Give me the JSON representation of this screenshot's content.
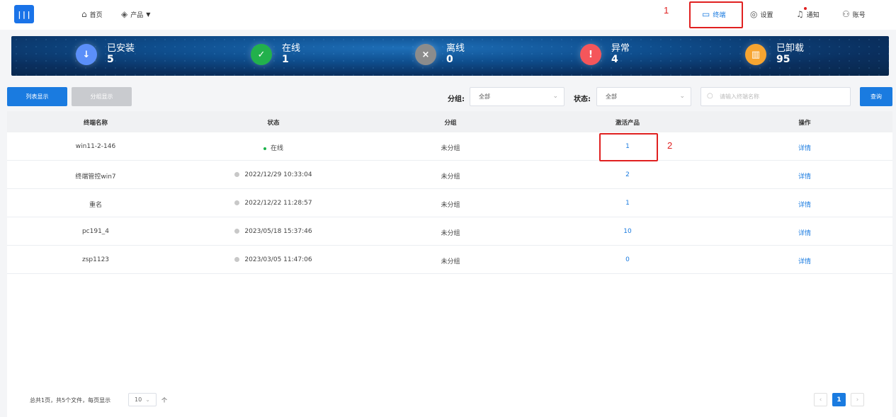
{
  "topbar": {
    "logo_text": "|||",
    "nav": [
      {
        "icon": "home-icon",
        "label": "首页"
      },
      {
        "icon": "layers-icon",
        "label": "产品"
      }
    ],
    "right": [
      {
        "icon": "monitor-icon",
        "label": "终端",
        "active": true
      },
      {
        "icon": "gear-icon",
        "label": "设置"
      },
      {
        "icon": "bell-icon",
        "label": "通知"
      },
      {
        "icon": "user-icon",
        "label": "账号"
      }
    ],
    "annotation_1": "1"
  },
  "stats": [
    {
      "label": "已安装",
      "value": "5",
      "color": "#5b8ff9"
    },
    {
      "label": "在线",
      "value": "1",
      "color": "#22b14c"
    },
    {
      "label": "离线",
      "value": "0",
      "color": "#8c8c8c"
    },
    {
      "label": "异常",
      "value": "4",
      "color": "#f5565b"
    },
    {
      "label": "已卸载",
      "value": "95",
      "color": "#f7a531"
    }
  ],
  "toolbar": {
    "list_view": "列表显示",
    "group_view": "分组显示",
    "group_label": "分组:",
    "group_value": "全部",
    "status_label": "状态:",
    "status_value": "全部",
    "search_placeholder": "请输入终端名称",
    "query": "查询"
  },
  "table": {
    "headers": [
      "终端名称",
      "状态",
      "分组",
      "激活产品",
      "操作"
    ],
    "rows": [
      {
        "name": "win11-2-146",
        "status": "在线",
        "online": true,
        "group": "未分组",
        "products": "1",
        "action": "详情"
      },
      {
        "name": "终端管控win7",
        "status": "2022/12/29 10:33:04",
        "online": false,
        "group": "未分组",
        "products": "2",
        "action": "详情"
      },
      {
        "name": "重名",
        "status": "2022/12/22 11:28:57",
        "online": false,
        "group": "未分组",
        "products": "1",
        "action": "详情"
      },
      {
        "name": "pc191_4",
        "status": "2023/05/18 15:37:46",
        "online": false,
        "group": "未分组",
        "products": "10",
        "action": "详情"
      },
      {
        "name": "zsp1123",
        "status": "2023/03/05 11:47:06",
        "online": false,
        "group": "未分组",
        "products": "0",
        "action": "详情"
      }
    ],
    "annotation_2": "2"
  },
  "footer": {
    "summary": "总共1页，共5个文件，每页显示",
    "page_size": "10",
    "unit": "个",
    "current_page": "1"
  },
  "colors": {
    "primary": "#1a7be0",
    "annotation": "#e02020"
  }
}
